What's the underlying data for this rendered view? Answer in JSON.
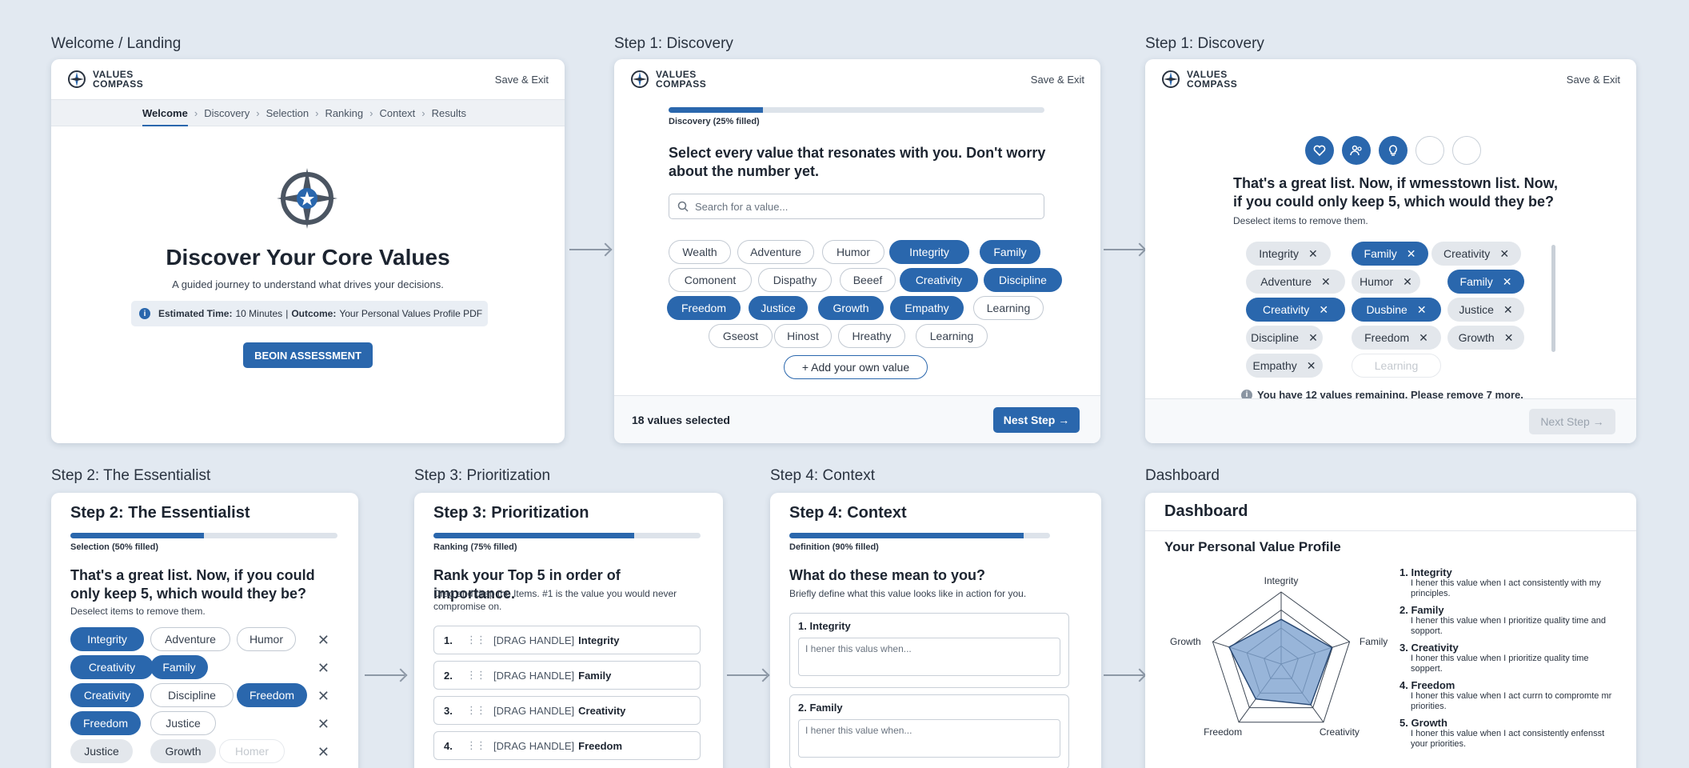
{
  "brand": {
    "line1": "VALUES",
    "line2": "COMPASS",
    "save": "Save & Exit"
  },
  "labels": {
    "welcome": "Welcome / Landing",
    "disc1": "Step 1: Discovery",
    "disc2": "Step 1: Discovery",
    "ess": "Step 2: The Essentialist",
    "prio": "Step 3: Prioritization",
    "ctx": "Step 4: Context",
    "dash": "Dashboard"
  },
  "welcome": {
    "breadcrumb": [
      "Welcome",
      "Discovery",
      "Selection",
      "Ranking",
      "Context",
      "Results"
    ],
    "title": "Discover Your Core Values",
    "subtitle": "A guided journey to understand what drives your decisions.",
    "info_time_label": "Estimated Time:",
    "info_time_value": "10 Minutes",
    "info_sep": "|",
    "info_outcome_label": "Outcome:",
    "info_outcome_value": "Your Personal Values Profile PDF",
    "cta": "BEOIN ASSESSMENT"
  },
  "disc1": {
    "progress_label": "Discovery (25% filled)",
    "progress": 0.25,
    "question": "Select every value that resonates with you. Don't worry about the number yet.",
    "search_placeholder": "Search for a value...",
    "chips": [
      {
        "t": "Wealth",
        "s": false
      },
      {
        "t": "Adventure",
        "s": false
      },
      {
        "t": "Humor",
        "s": false
      },
      {
        "t": "Integrity",
        "s": true
      },
      {
        "t": "Family",
        "s": true
      },
      {
        "t": "Comonent",
        "s": false
      },
      {
        "t": "Dispathy",
        "s": false
      },
      {
        "t": "Beeef",
        "s": false
      },
      {
        "t": "Creativity",
        "s": true
      },
      {
        "t": "Discipline",
        "s": true
      },
      {
        "t": "Freedom",
        "s": true
      },
      {
        "t": "Justice",
        "s": true
      },
      {
        "t": "Growth",
        "s": true
      },
      {
        "t": "Empathy",
        "s": true
      },
      {
        "t": "Learning",
        "s": false
      },
      {
        "t": "Gseost",
        "s": false
      },
      {
        "t": "Hinost",
        "s": false
      },
      {
        "t": "Hreathy",
        "s": false
      },
      {
        "t": "Learning",
        "s": false
      }
    ],
    "add": "+ Add your own value",
    "count": "18 values selected",
    "next": "Nest Step →"
  },
  "disc2": {
    "question": "That's a great list. Now, if wmesstown list. Now, if you could only keep 5, which would they be?",
    "sub": "Deselect items to remove them.",
    "chips": [
      {
        "t": "Integrity",
        "k": "grey"
      },
      {
        "t": "Family",
        "k": "sel"
      },
      {
        "t": "Creativity",
        "k": "grey"
      },
      {
        "t": "Adventure",
        "k": "grey"
      },
      {
        "t": "Humor",
        "k": "grey"
      },
      {
        "t": "Family",
        "k": "sel"
      },
      {
        "t": "Creativity",
        "k": "sel"
      },
      {
        "t": "Dusbine",
        "k": "sel"
      },
      {
        "t": "Justice",
        "k": "grey"
      },
      {
        "t": "Discipline",
        "k": "grey"
      },
      {
        "t": "Freedom",
        "k": "grey"
      },
      {
        "t": "Growth",
        "k": "grey"
      },
      {
        "t": "Empathy",
        "k": "grey"
      },
      {
        "t": "Learning",
        "k": "ghost"
      }
    ],
    "warning": "You have 12 values remaining. Please remove 7 more.",
    "next": "Next Step →"
  },
  "ess": {
    "title": "Step 2: The Essentialist",
    "progress_label": "Selection (50% filled)",
    "progress": 0.5,
    "question": "That's a great list. Now, if you could only keep 5, which would they be?",
    "sub": "Deselect items to remove them.",
    "chips": [
      {
        "t": "Integrity",
        "k": "sel"
      },
      {
        "t": "Adventure",
        "k": "out"
      },
      {
        "t": "Humor",
        "k": "out"
      },
      {
        "t": "Creativity",
        "k": "sel"
      },
      {
        "t": "Family",
        "k": "sel"
      },
      {
        "t": "Creativity",
        "k": "sel"
      },
      {
        "t": "Discipline",
        "k": "out"
      },
      {
        "t": "Freedom",
        "k": "sel"
      },
      {
        "t": "Freedom",
        "k": "sel"
      },
      {
        "t": "Justice",
        "k": "out"
      },
      {
        "t": "Justice",
        "k": "grey"
      },
      {
        "t": "Growth",
        "k": "grey"
      },
      {
        "t": "Homer",
        "k": "ghost"
      }
    ]
  },
  "prio": {
    "title": "Step 3: Prioritization",
    "progress_label": "Ranking (75% filled)",
    "progress": 0.75,
    "question": "Rank your Top 5 in order of importance.",
    "sub": "Drag and drep the Items. #1 is the value you would never compromise on.",
    "handle": "[DRAG HANDLE]",
    "items": [
      {
        "n": "1.",
        "v": "Integrity"
      },
      {
        "n": "2.",
        "v": "Family"
      },
      {
        "n": "3.",
        "v": "Creativity"
      },
      {
        "n": "4.",
        "v": "Freedom"
      }
    ]
  },
  "ctx": {
    "title": "Step 4: Context",
    "progress_label": "Definition (90% filled)",
    "progress": 0.9,
    "question": "What do these mean to you?",
    "sub": "Briefly define what this value looks like in action for you.",
    "items": [
      {
        "t": "1. Integrity",
        "p": "I hener this valus when..."
      },
      {
        "t": "2. Family",
        "p": "I hener this value when..."
      }
    ]
  },
  "dash": {
    "title": "Dashboard",
    "profile": "Your Personal Value Profile",
    "axes": [
      "Integrity",
      "Family",
      "Creativity",
      "Freedom",
      "Growth"
    ],
    "scores": [
      0.62,
      0.74,
      0.7,
      0.6,
      0.76
    ],
    "list": [
      {
        "t": "1. Integrity",
        "d": "I hener this value when I act consistently with my principles."
      },
      {
        "t": "2. Family",
        "d": "I hener this value when I prioritize quality time and sopport."
      },
      {
        "t": "3. Creativity",
        "d": "I honer this value when I prioritize quality time soppert."
      },
      {
        "t": "4. Freedom",
        "d": "I honer this value when I act currn to compromte mr priorities."
      },
      {
        "t": "5. Growth",
        "d": "I honer this value when I act consistently enfensst your priorities."
      }
    ]
  }
}
